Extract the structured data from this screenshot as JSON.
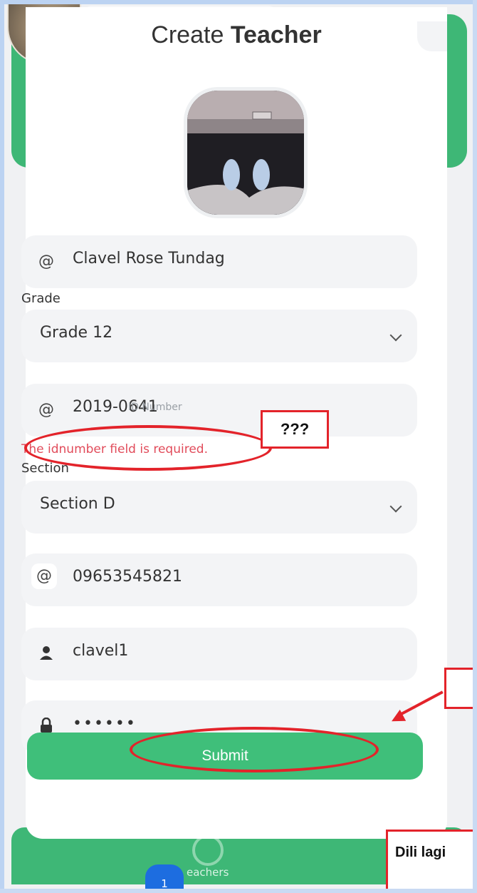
{
  "modal": {
    "title_light": "Create",
    "title_bold": "Teacher"
  },
  "form": {
    "name": {
      "value": "Clavel Rose Tundag",
      "icon": "at-icon"
    },
    "grade": {
      "label": "Grade",
      "value": "Grade 12"
    },
    "idnumber": {
      "value": "2019-0641",
      "ghost_placeholder": "ID Number",
      "error": "The idnumber field is required.",
      "icon": "at-icon"
    },
    "section": {
      "label": "Section",
      "value": "Section D"
    },
    "contact": {
      "value": "09653545821",
      "icon": "at-icon"
    },
    "username": {
      "value": "clavel1",
      "icon": "user-icon"
    },
    "password": {
      "value": "••••••",
      "icon": "lock-icon"
    },
    "submit_label": "Submit"
  },
  "background": {
    "tab_badge": "1",
    "tab_label": "eachers"
  },
  "annotations": {
    "question_box": "???",
    "dili_lagi_box": "Dili lagi"
  },
  "colors": {
    "accent_green": "#3fbf7a",
    "error_red": "#e14b5a",
    "annotation_red": "#e3232a",
    "badge_blue": "#1d6de0"
  }
}
